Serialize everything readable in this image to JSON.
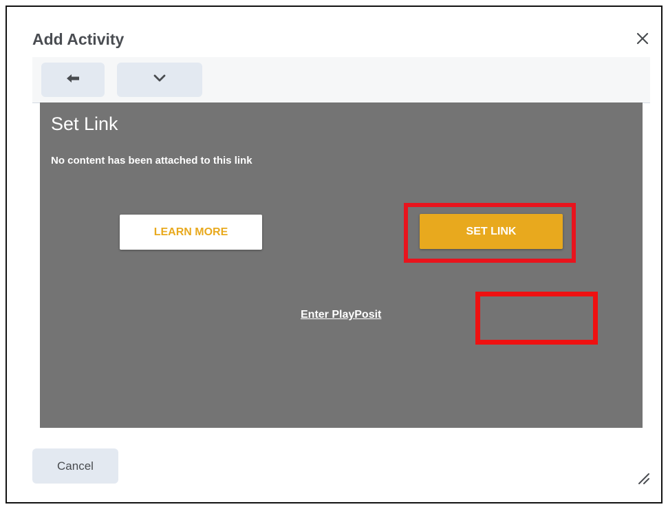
{
  "dialog": {
    "title": "Add Activity",
    "close_icon": "close-icon"
  },
  "toolbar": {
    "back_icon": "arrow-left-icon",
    "more_icon": "chevron-down-icon"
  },
  "panel": {
    "title": "Set Link",
    "subtitle": "No content has been attached to this link",
    "learn_more_label": "LEARN MORE",
    "set_link_label": "SET LINK",
    "enter_link_text": "Enter PlayPosit"
  },
  "footer": {
    "cancel_label": "Cancel",
    "resize_icon": "resize-handle-icon"
  },
  "colors": {
    "accent": "#e8a91e",
    "panel_bg": "#747474",
    "highlight": "#e8141d"
  }
}
